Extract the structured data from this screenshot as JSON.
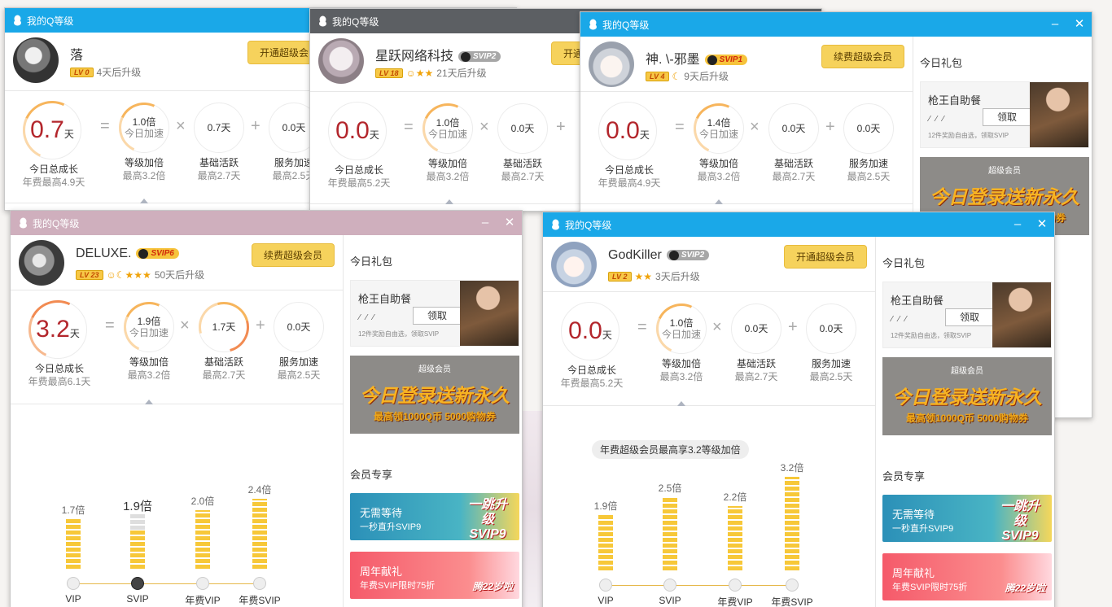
{
  "windows": [
    {
      "id": "w1",
      "title": "我的Q等级",
      "user": {
        "name": "落",
        "level": "LV 0",
        "upgrade": "4天后升级",
        "svip": "",
        "icons": ""
      },
      "vip_button": "开通超级会员",
      "formula": {
        "total": "0.7",
        "unit": "天",
        "total_label": "今日总成长",
        "total_max": "年费最高4.9天",
        "level_mult": "1.0倍",
        "level_mult_sub": "今日加速",
        "level_label": "等级加倍",
        "level_max": "最高3.2倍",
        "active": "0.7天",
        "active_label": "基础活跃",
        "active_max": "最高2.7天",
        "service": "0.0天",
        "service_label": "服务加速",
        "service_max": "最高2.5天"
      }
    },
    {
      "id": "w2",
      "title": "我的Q等级",
      "user": {
        "name": "星跃网络科技",
        "level": "LV 18",
        "upgrade": "21天后升级",
        "svip": "SVIP2",
        "icons": "☺★★"
      },
      "vip_button": "开通超级会员",
      "formula": {
        "total": "0.0",
        "unit": "天",
        "total_label": "今日总成长",
        "total_max": "年费最高5.2天",
        "level_mult": "1.0倍",
        "level_mult_sub": "今日加速",
        "level_label": "等级加倍",
        "level_max": "最高3.2倍",
        "active": "0.0天",
        "active_label": "基础活跃",
        "active_max": "最高2.7天",
        "service": "",
        "service_label": "",
        "service_max": ""
      }
    },
    {
      "id": "w3",
      "title": "我的Q等级",
      "user": {
        "name": "神. \\-邪墨",
        "level": "LV 4",
        "upgrade": "9天后升级",
        "svip": "SVIP1",
        "icons": "☾"
      },
      "vip_button": "续费超级会员",
      "formula": {
        "total": "0.0",
        "unit": "天",
        "total_label": "今日总成长",
        "total_max": "年费最高4.9天",
        "level_mult": "1.4倍",
        "level_mult_sub": "今日加速",
        "level_label": "等级加倍",
        "level_max": "最高3.2倍",
        "active": "0.0天",
        "active_label": "基础活跃",
        "active_max": "最高2.7天",
        "service": "0.0天",
        "service_label": "服务加速",
        "service_max": "最高2.5天"
      },
      "side": {
        "gift_title": "今日礼包",
        "gift_name": "枪王自助餐",
        "claim": "领取",
        "gift_desc": "12件奖励自由选，领取SVIP",
        "promo_top": "超级会员",
        "promo_main": "今日登录送新永久",
        "promo_sub": "最高领1000Q币 5000购物券"
      }
    },
    {
      "id": "w4",
      "title": "我的Q等级",
      "user": {
        "name": "DELUXE.",
        "level": "LV 23",
        "upgrade": "50天后升级",
        "svip": "SVIP6",
        "icons": "☺☾★★★"
      },
      "vip_button": "续费超级会员",
      "formula": {
        "total": "3.2",
        "unit": "天",
        "total_label": "今日总成长",
        "total_max": "年费最高6.1天",
        "level_mult": "1.9倍",
        "level_mult_sub": "今日加速",
        "level_label": "等级加倍",
        "level_max": "最高3.2倍",
        "active": "1.7天",
        "active_label": "基础活跃",
        "active_max": "最高2.7天",
        "service": "0.0天",
        "service_label": "服务加速",
        "service_max": "最高2.5天"
      },
      "chart": {
        "labels": [
          "VIP",
          "SVIP",
          "年费VIP",
          "年费SVIP"
        ],
        "values": [
          "1.7倍",
          "1.9倍",
          "2.0倍",
          "2.4倍"
        ],
        "nums": [
          1.7,
          1.9,
          2.0,
          2.4
        ],
        "current": 1
      },
      "side": {
        "gift_title": "今日礼包",
        "gift_name": "枪王自助餐",
        "claim": "领取",
        "gift_desc": "12件奖励自由选，领取SVIP",
        "promo_top": "超级会员",
        "promo_main": "今日登录送新永久",
        "promo_sub": "最高领1000Q币 5000购物券",
        "member_title": "会员专享",
        "banner1_a": "无需等待",
        "banner1_b": "一秒直升SVIP9",
        "banner1_deco": "一跳升级 SVIP9",
        "banner2_a": "周年献礼",
        "banner2_b": "年费SVIP限时75折",
        "banner2_deco": "腾22岁啦"
      }
    },
    {
      "id": "w5",
      "title": "我的Q等级",
      "user": {
        "name": "GodKiller",
        "level": "LV 2",
        "upgrade": "3天后升级",
        "svip": "SVIP2",
        "icons": "★★"
      },
      "vip_button": "开通超级会员",
      "formula": {
        "total": "0.0",
        "unit": "天",
        "total_label": "今日总成长",
        "total_max": "年费最高5.2天",
        "level_mult": "1.0倍",
        "level_mult_sub": "今日加速",
        "level_label": "等级加倍",
        "level_max": "最高3.2倍",
        "active": "0.0天",
        "active_label": "基础活跃",
        "active_max": "最高2.7天",
        "service": "0.0天",
        "service_label": "服务加速",
        "service_max": "最高2.5天"
      },
      "chart": {
        "bubble": "年费超级会员最高享3.2等级加倍",
        "labels": [
          "VIP",
          "SVIP",
          "年费VIP",
          "年费SVIP"
        ],
        "values": [
          "1.9倍",
          "2.5倍",
          "2.2倍",
          "3.2倍"
        ],
        "nums": [
          1.9,
          2.5,
          2.2,
          3.2
        ],
        "current": -1
      },
      "side": {
        "gift_title": "今日礼包",
        "gift_name": "枪王自助餐",
        "claim": "领取",
        "gift_desc": "12件奖励自由选，领取SVIP",
        "promo_top": "超级会员",
        "promo_main": "今日登录送新永久",
        "promo_sub": "最高领1000Q币 5000购物券",
        "member_title": "会员专享",
        "banner1_a": "无需等待",
        "banner1_b": "一秒直升SVIP9",
        "banner1_deco": "一跳升级 SVIP9",
        "banner2_a": "周年献礼",
        "banner2_b": "年费SVIP限时75折",
        "banner2_deco": "腾22岁啦"
      }
    }
  ],
  "controls": {
    "minimize": "–",
    "close": "✕"
  },
  "colors": {
    "title_blue": "#1aa8e8",
    "title_gray": "#5c5f63",
    "title_pink": "#cfafbd",
    "accent_red": "#b3262c",
    "bar_gold": "#f7c839"
  }
}
